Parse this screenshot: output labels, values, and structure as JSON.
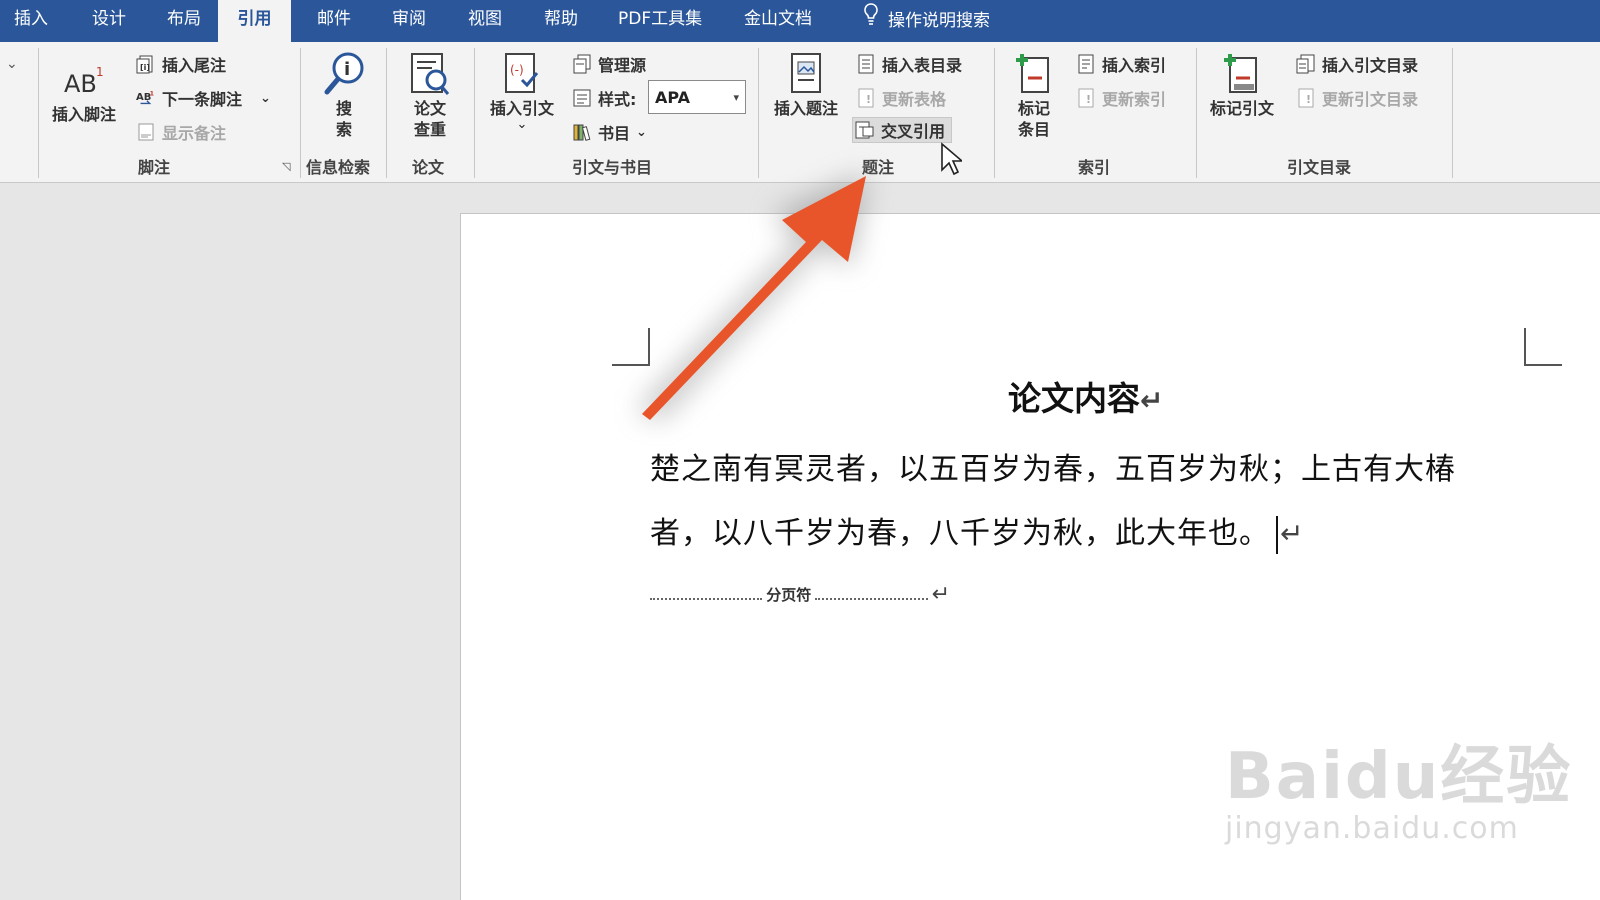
{
  "tabs": [
    {
      "label": "插入"
    },
    {
      "label": "设计"
    },
    {
      "label": "布局"
    },
    {
      "label": "引用"
    },
    {
      "label": "邮件"
    },
    {
      "label": "审阅"
    },
    {
      "label": "视图"
    },
    {
      "label": "帮助"
    },
    {
      "label": "PDF工具集"
    },
    {
      "label": "金山文档"
    },
    {
      "label": "操作说明搜索"
    }
  ],
  "ribbon": {
    "footnotes": {
      "group_label": "脚注",
      "insert_footnote": "插入脚注",
      "insert_endnote": "插入尾注",
      "next_footnote": "下一条脚注",
      "show_notes": "显示备注"
    },
    "research": {
      "group_label": "信息检索",
      "search": "搜索"
    },
    "thesis": {
      "group_label": "论文",
      "check": "论文查重"
    },
    "citations": {
      "group_label": "引文与书目",
      "insert_citation": "插入引文",
      "manage_sources": "管理源",
      "style_label": "样式:",
      "style_value": "APA",
      "bibliography": "书目"
    },
    "captions": {
      "group_label": "题注",
      "insert_caption": "插入题注",
      "insert_table_of_figures": "插入表目录",
      "update_table": "更新表格",
      "cross_reference": "交叉引用"
    },
    "index": {
      "group_label": "索引",
      "mark_entry": "标记条目",
      "insert_index": "插入索引",
      "update_index": "更新索引"
    },
    "toa": {
      "group_label": "引文目录",
      "mark_citation": "标记引文",
      "insert_toa": "插入引文目录",
      "update_toa": "更新引文目录"
    }
  },
  "document": {
    "title": "论文内容",
    "para_line1": "楚之南有冥灵者，以五百岁为春，五百岁为秋；上古有大椿",
    "para_line2": "者，以八千岁为春，八千岁为秋，此大年也。",
    "page_break": "分页符",
    "return_mark": "↵"
  },
  "watermark": {
    "main": "Baidu经验",
    "sub": "jingyan.baidu.com"
  },
  "colors": {
    "tab_bar": "#2b579a",
    "arrow": "#e8552a"
  }
}
